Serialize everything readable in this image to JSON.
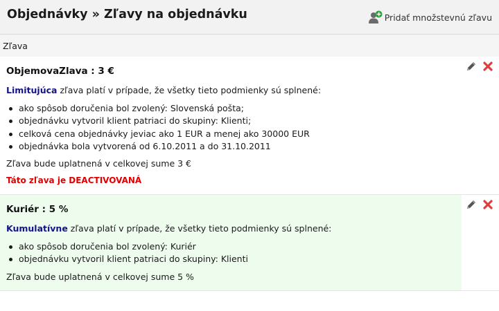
{
  "header": {
    "title": "Objednávky » Zľavy na objednávku",
    "add_button_label": "Pridať množstevnú zľavu",
    "add_icon": "add-user-icon"
  },
  "section": {
    "label": "Zľava"
  },
  "discounts": [
    {
      "title": "ObjemovaZlava : 3 €",
      "type_label": "Limitujúca",
      "condition_text": " zľava platí v prípade, že všetky tieto podmienky sú splnené:",
      "rules": [
        "ako spôsob doručenia bol zvolený: Slovenská pošta;",
        "objednávku vytvoril klient patriaci do skupiny: Klienti;",
        "celková cena objednávky jeviac ako 1 EUR a menej ako 30000 EUR",
        "objednávka bola vytvorená od 6.10.2011 a do 31.10.2011"
      ],
      "applied_text": "Zľava bude uplatnená v celkovej sume 3 €",
      "status_text": "Táto zľava je DEACTIVOVANÁ"
    },
    {
      "title": "Kuriér : 5 %",
      "type_label": "Kumulatívne",
      "condition_text": " zľava platí v prípade, že všetky tieto podmienky sú splnené:",
      "rules": [
        "ako spôsob doručenia bol zvolený: Kuriér",
        "objednávku vytvoril klient patriaci do skupiny: Klienti"
      ],
      "applied_text": "Zľava bude uplatnená v celkovej sume 5 %"
    }
  ],
  "colors": {
    "type_label": "#141488",
    "status_inactive": "#e00000",
    "highlight_bg": "#edfced",
    "delete_icon": "#e03c3c"
  }
}
